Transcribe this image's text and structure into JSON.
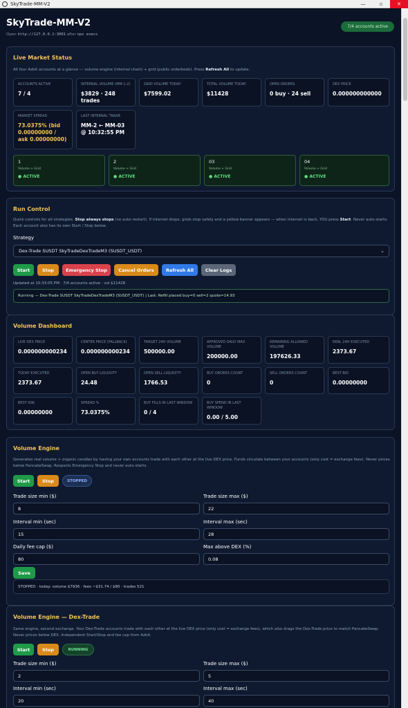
{
  "window": {
    "title": "SkyTrade-MM-V2",
    "min": "—",
    "max": "▫",
    "close": "✕"
  },
  "header": {
    "title": "SkyTrade-MM-V2",
    "subtitle_prefix": "Open",
    "subtitle_url": "http://127.0.0.1:3001",
    "subtitle_suffix": "after",
    "subtitle_cmd": "npx  execs",
    "badge": "7/4 accounts active"
  },
  "market": {
    "title": "Live Market Status",
    "desc_pre": "All four Azbit accounts at a glance — volume engine (internal chart) + grid (public orderbook). Press ",
    "desc_bold": "Refresh All",
    "desc_post": " to update.",
    "stats": [
      {
        "label": "ACCOUNTS ACTIVE",
        "value": "7 / 4"
      },
      {
        "label": "INTERNAL VOLUME (MM-1-2)",
        "value": "$3829 · 248 trades"
      },
      {
        "label": "GRID VOLUME TODAY",
        "value": "$7599.02"
      },
      {
        "label": "TOTAL VOLUME TODAY",
        "value": "$11428"
      },
      {
        "label": "OPEN ORDERS",
        "value": "0 buy · 24 sell"
      },
      {
        "label": "DEX PRICE",
        "value": "0.000000000000"
      },
      {
        "label": "MARKET SPREAD",
        "value": "73.0375% (bid 0.00000000 / ask 0.00000000)"
      },
      {
        "label": "LAST INTERNAL TRADE",
        "value": "MM-2 ← MM-03 @ 10:32:55 PM"
      }
    ],
    "accounts": [
      {
        "name": "1",
        "sub": "Volume + Grid",
        "status": "● ACTIVE"
      },
      {
        "name": "2",
        "sub": "Volume + Grid",
        "status": "● ACTIVE"
      },
      {
        "name": "03",
        "sub": "Volume + Grid",
        "status": "● ACTIVE"
      },
      {
        "name": "04",
        "sub": "Volume + Grid",
        "status": "● ACTIVE"
      }
    ]
  },
  "run": {
    "title": "Run Control",
    "desc_pre": "Quick controls for all strategies. ",
    "desc_bold": "Stop always stops",
    "desc_mid": " (no auto-restart). If internet drops, grids stop safely and a yellow banner appears — when internet is back, YOU press ",
    "desc_bold2": "Start",
    "desc_post": ". Never auto-starts. Each account also has its own Start / Stop below.",
    "strategy_label": "Strategy",
    "strategy_value": "Dex-Trade SUSDT SkyTradeDexTradeM3 (SUSDT_USDT)",
    "buttons": {
      "start": "Start",
      "stop": "Stop",
      "emergency": "Emergency Stop",
      "cancel": "Cancel Orders",
      "refresh": "Refresh All",
      "clear": "Clear Logs"
    },
    "updated": "Updated at 10:33:05 PM · 7/4 accounts active · vol $11428",
    "log": "Running — Dex-Trade SUSDT SkyTradeDexTradeM3 (SUSDT_USDT) | Last: Refill placed buy=0 sell=2 quote=14.93"
  },
  "volume": {
    "title": "Volume Dashboard",
    "stats": [
      {
        "label": "LIVE DEX PRICE",
        "value": "0.000000000234"
      },
      {
        "label": "CENTER PRICE (FALLBACK)",
        "value": "0.000000000234"
      },
      {
        "label": "TARGET 24H VOLUME",
        "value": "500000.00"
      },
      {
        "label": "APPROVED DAILY MAX VOLUME",
        "value": "200000.00"
      },
      {
        "label": "REMAINING ALLOWED VOLUME",
        "value": "197626.33"
      },
      {
        "label": "REAL 24H EXECUTED",
        "value": "2373.67"
      },
      {
        "label": "TODAY EXECUTED",
        "value": "2373.67"
      },
      {
        "label": "OPEN BUY LIQUIDITY",
        "value": "24.48"
      },
      {
        "label": "OPEN SELL LIQUIDITY",
        "value": "1766.53"
      },
      {
        "label": "BUY ORDERS COUNT",
        "value": "0"
      },
      {
        "label": "SELL ORDERS COUNT",
        "value": "0"
      },
      {
        "label": "BEST BID",
        "value": "0.00000000"
      },
      {
        "label": "BEST ASK",
        "value": "0.00000000"
      },
      {
        "label": "SPREAD %",
        "value": "73.0375%"
      },
      {
        "label": "BUY FILLS IN LAST WINDOW",
        "value": "0 / 4"
      },
      {
        "label": "BUY SPEND IN LAST WINDOW",
        "value": "0.00 / 5.00"
      }
    ]
  },
  "engine": {
    "title": "Volume Engine",
    "desc": "Generates real volume + organic candles by having your own accounts trade with each other at the live DEX price. Funds circulate between your accounts (only cost = exchange fees). Never prices below PancakeSwap. Respects Emergency Stop and never auto-starts.",
    "start": "Start",
    "stop": "Stop",
    "status": "STOPPED",
    "fields": {
      "trade_min_label": "Trade size min ($)",
      "trade_min": "8",
      "trade_max_label": "Trade size max ($)",
      "trade_max": "22",
      "int_min_label": "Interval min (sec)",
      "int_min": "15",
      "int_max_label": "Interval max (sec)",
      "int_max": "28",
      "fee_label": "Daily fee cap ($)",
      "fee": "80",
      "above_label": "Max above DEX (%)",
      "above": "0.08"
    },
    "save": "Save",
    "log": "STOPPED · today: volume $7936 · fees ~$31.74 / $80 · trades 521"
  },
  "engine2": {
    "title": "Volume Engine — Dex-Trade",
    "desc": "Same engine, second exchange. Your Dex-Trade accounts trade with each other at the live DEX price (only cost = exchange fees), which also drags the Dex-Trade price to match PancakeSwap. Never prices below DEX. Independent Start/Stop and fee cap from Azbit.",
    "start": "Start",
    "stop": "Stop",
    "status": "RUNNING",
    "fields": {
      "trade_min_label": "Trade size min ($)",
      "trade_min": "2",
      "trade_max_label": "Trade size max ($)",
      "trade_max": "5",
      "int_min_label": "Interval min (sec)",
      "int_min": "20",
      "int_max_label": "Interval max (sec)",
      "int_max": "40"
    }
  }
}
